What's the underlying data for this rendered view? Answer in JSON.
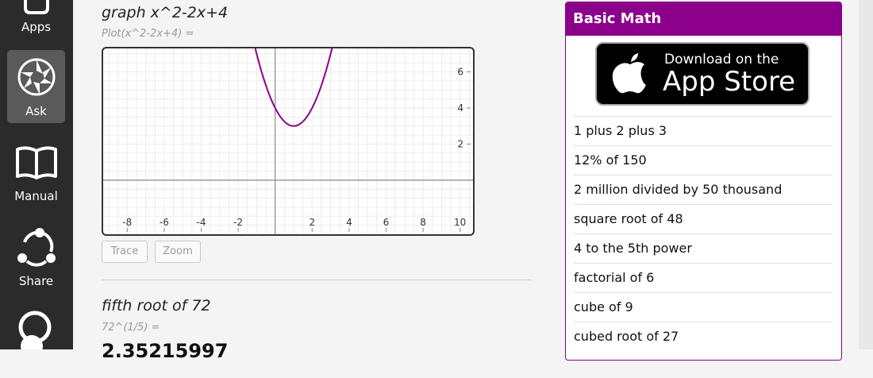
{
  "sidebar": {
    "items": [
      {
        "label": "Apps",
        "icon": "apps-icon"
      },
      {
        "label": "Ask",
        "icon": "ask-icon",
        "active": true
      },
      {
        "label": "Manual",
        "icon": "book-icon"
      },
      {
        "label": "Share",
        "icon": "share-icon"
      },
      {
        "label": "",
        "icon": "user-icon"
      }
    ]
  },
  "main": {
    "queries": [
      {
        "title": "graph x^2-2x+4",
        "subtitle": "Plot(x^2-2x+4) ="
      },
      {
        "title": "fifth root of 72",
        "subtitle": "72^(1/5) =",
        "answer": "2.35215997"
      }
    ],
    "graph_buttons": {
      "trace": "Trace",
      "zoom": "Zoom"
    }
  },
  "chart_data": {
    "type": "line",
    "title": "",
    "xlabel": "",
    "ylabel": "",
    "xlim": [
      -9.3,
      10.7
    ],
    "ylim": [
      -3.0,
      7.3
    ],
    "x_ticks": [
      -8,
      -6,
      -4,
      -2,
      2,
      4,
      6,
      8,
      10
    ],
    "y_ticks": [
      2,
      4,
      6
    ],
    "x_tick_labels": [
      "-8",
      "-6",
      "-4",
      "-2",
      "2",
      "4",
      "6",
      "8",
      "10"
    ],
    "y_tick_labels": [
      "2",
      "4",
      "6"
    ],
    "grid": true,
    "series": [
      {
        "expression": "x^2-2x+4",
        "color": "#8b008b"
      }
    ]
  },
  "panel": {
    "title": "Basic Math",
    "accent": "#8b008b",
    "appstore": {
      "small": "Download on the",
      "big": "App Store"
    },
    "examples": [
      "1 plus 2 plus 3",
      "12% of 150",
      "2 million divided by 50 thousand",
      "square root of 48",
      "4 to the 5th power",
      "factorial of 6",
      "cube of 9",
      "cubed root of 27"
    ]
  }
}
